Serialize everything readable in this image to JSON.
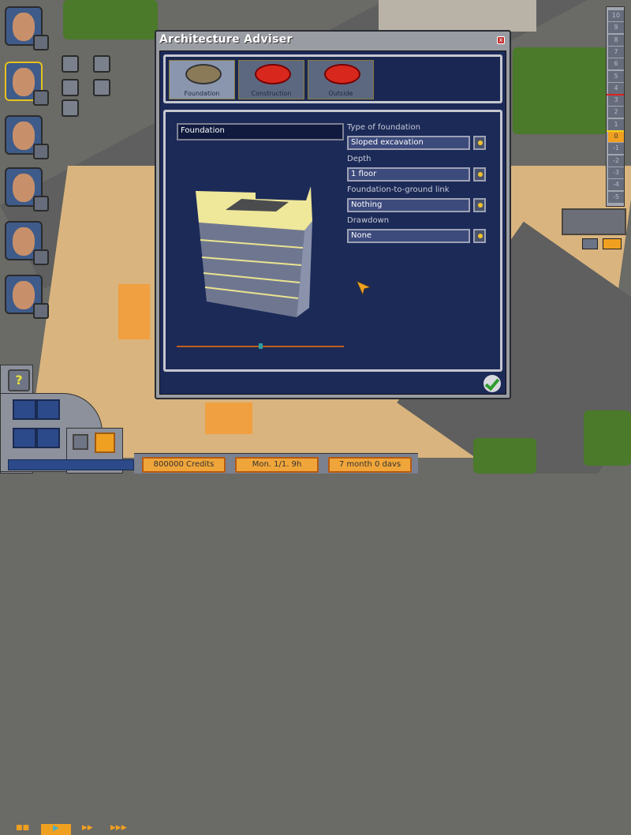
{
  "dialog": {
    "title": "Architecture Adviser",
    "close_label": "x",
    "tabs": [
      {
        "label": "Foundation",
        "icon": "foundation-pit-icon",
        "active": true
      },
      {
        "label": "Construction",
        "icon": "traffic-cone-icon",
        "active": false
      },
      {
        "label": "Outside",
        "icon": "traffic-cone-icon",
        "active": false
      }
    ],
    "name_field": "Foundation",
    "fields": [
      {
        "label": "Type of foundation",
        "value": "Sloped excavation"
      },
      {
        "label": "Depth",
        "value": "1 floor"
      },
      {
        "label": "Foundation-to-ground link",
        "value": "Nothing"
      },
      {
        "label": "Drawdown",
        "value": "None"
      }
    ],
    "preview_rotation": 0.5,
    "confirm_icon": "checkmark-icon"
  },
  "advisers": [
    {
      "name": "construction-worker",
      "badge": "traffic-cone-icon"
    },
    {
      "name": "architect",
      "badge": "set-square-icon",
      "active": true
    },
    {
      "name": "designer",
      "badge": "figures-icon"
    },
    {
      "name": "engineer",
      "badge": "bulldozer-icon"
    },
    {
      "name": "logistics",
      "badge": "truck-icon"
    },
    {
      "name": "accountant",
      "badge": "bar-chart-icon"
    }
  ],
  "floor_selector": {
    "floors": [
      "10",
      "9",
      "8",
      "7",
      "6",
      "5",
      "4",
      "3",
      "2",
      "1",
      "0",
      "-1",
      "-2",
      "-3",
      "-4",
      "-5"
    ],
    "current": "0"
  },
  "status": {
    "credits": "800000 Credits",
    "date": "Mon. 1/1. 9h",
    "duration": "7 month 0 davs"
  },
  "controls": {
    "help": "?",
    "speed_options": [
      "pause",
      "play",
      "fast",
      "fastest"
    ],
    "speed_selected": "play"
  }
}
